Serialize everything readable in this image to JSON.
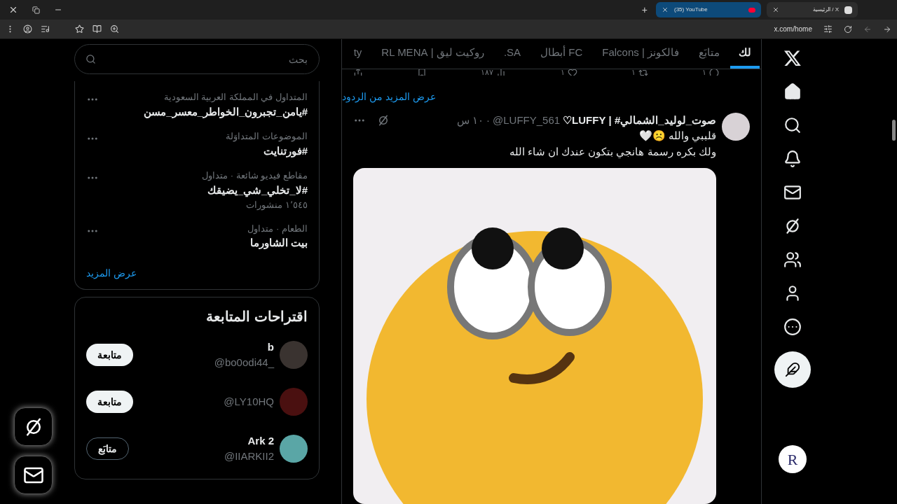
{
  "browser": {
    "tabs": [
      {
        "title": "X / الرئيسية",
        "selected": true
      },
      {
        "title": "(35) YouTube",
        "selected": false
      }
    ],
    "new_tab": "+",
    "address": "x.com/home"
  },
  "sidebar": {
    "search": {
      "placeholder": "بحث"
    },
    "trends": [
      {
        "context": "المتداول في المملكة العربية السعودية",
        "title": "#يامن_تجبرون_الخواطر_معسر_مسن"
      },
      {
        "context": "الموضوعات المتداوَلة",
        "title": "#فورتنايت"
      },
      {
        "context": "مقاطع فيديو شائعة · متداول",
        "title": "#لا_تخلي_شي_يضيقك",
        "posts": "١٬٥٤٥ منشورات"
      },
      {
        "context": "الطعام · متداول",
        "title": "بيت الشاورما"
      }
    ],
    "show_more": "عرض المزيد",
    "suggestions": {
      "title": "اقتراحات المتابعة",
      "users": [
        {
          "name": "b",
          "handle": "@bo0odi44_",
          "button": "متابعة",
          "following": false
        },
        {
          "handle": "@LY10HQ",
          "button": "متابعة",
          "following": false
        },
        {
          "name": "Ark 2",
          "handle": "@IIARKII2",
          "button": "متابَع",
          "following": true
        }
      ]
    }
  },
  "timeline_tabs": [
    {
      "label": "لك",
      "selected": true
    },
    {
      "label": "متابَع",
      "selected": false
    },
    {
      "label": "فالكونز | Falcons",
      "selected": false
    },
    {
      "label": "FC أبطال",
      "selected": false
    },
    {
      "label": "SA.",
      "selected": false
    },
    {
      "label": "روكيت ليق | RL MENA",
      "selected": false
    },
    {
      "label": "ty",
      "selected": false
    }
  ],
  "previous_tweet_actions": [
    {
      "kind": "reply",
      "count": "١"
    },
    {
      "kind": "retweet",
      "count": "١"
    },
    {
      "kind": "like",
      "count": "١"
    },
    {
      "kind": "views",
      "count": "١٨٧"
    },
    {
      "kind": "bookmark"
    },
    {
      "kind": "share"
    }
  ],
  "show_more_replies": "عرض المزيد من الردود",
  "tweet": {
    "display_name": "صوت_لوليد_الشمالي# | LUFFY♡",
    "handle": "@LUFFY_561",
    "separator": "·",
    "time": "١٠ س",
    "lines": [
      "قلببي والله ☹️🤍",
      "ولك بكره رسمة هانجي بتكون عندك ان شاء الله"
    ]
  },
  "account": {
    "avatar_text": "R"
  }
}
